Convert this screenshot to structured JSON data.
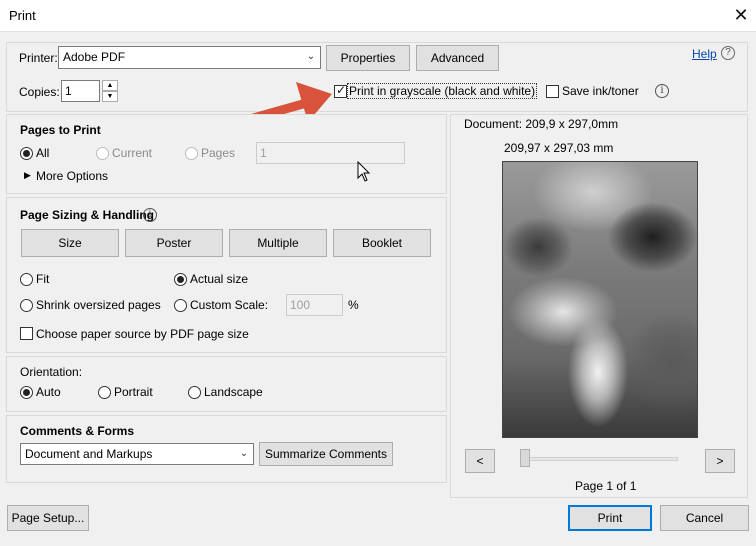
{
  "window": {
    "title": "Print"
  },
  "printer": {
    "label": "Printer:",
    "value": "Adobe PDF",
    "properties_label": "Properties",
    "advanced_label": "Advanced"
  },
  "help": {
    "label": "Help"
  },
  "copies": {
    "label": "Copies:",
    "value": "1"
  },
  "grayscale": {
    "label": "Print in grayscale (black and white)",
    "checked": true
  },
  "save_ink": {
    "label": "Save ink/toner",
    "checked": false
  },
  "pages_to_print": {
    "title": "Pages to Print",
    "all_label": "All",
    "current_label": "Current",
    "pages_label": "Pages",
    "pages_value": "1",
    "more_options_label": "More Options"
  },
  "sizing": {
    "title": "Page Sizing & Handling",
    "size_label": "Size",
    "poster_label": "Poster",
    "multiple_label": "Multiple",
    "booklet_label": "Booklet",
    "fit_label": "Fit",
    "actual_label": "Actual size",
    "shrink_label": "Shrink oversized pages",
    "custom_label": "Custom Scale:",
    "custom_value": "100",
    "percent_label": "%",
    "paper_source_label": "Choose paper source by PDF page size"
  },
  "orientation": {
    "title": "Orientation:",
    "auto_label": "Auto",
    "portrait_label": "Portrait",
    "landscape_label": "Landscape"
  },
  "comments": {
    "title": "Comments & Forms",
    "value": "Document and Markups",
    "summarize_label": "Summarize Comments"
  },
  "preview": {
    "document_size": "Document: 209,9 x 297,0mm",
    "paper_size": "209,97 x 297,03 mm",
    "prev_label": "<",
    "next_label": ">",
    "page_indicator": "Page 1 of 1"
  },
  "footer": {
    "page_setup_label": "Page Setup...",
    "print_label": "Print",
    "cancel_label": "Cancel"
  },
  "colors": {
    "accent": "#0078d7",
    "annotation_arrow": "#d9533c"
  }
}
